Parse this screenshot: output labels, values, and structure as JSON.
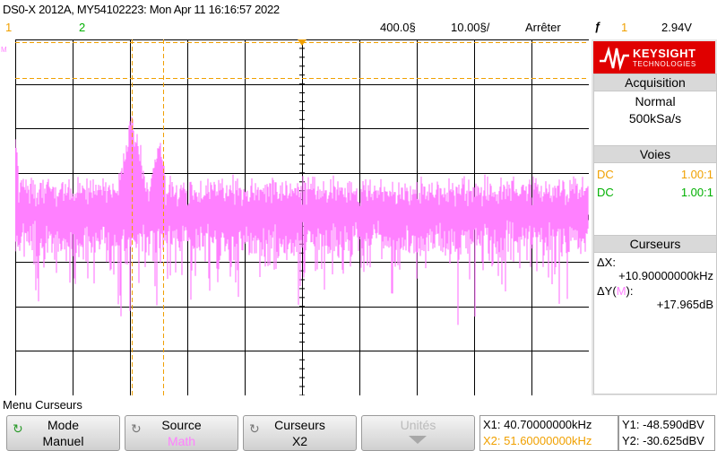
{
  "header": {
    "title": "DS0-X 2012A, MY54102223: Mon Apr 11 16:16:57 2022",
    "timebase": "400.0§",
    "delay": "10.00§/",
    "run_state": "Arrêter",
    "trigger_icon": "trigger-edge-icon",
    "trigger_symbol": "ƒ",
    "trigger_channel": "1",
    "trigger_level": "2.94V"
  },
  "channels_row": {
    "ch1": "1",
    "ch2": "2"
  },
  "colors": {
    "ch1": "#f0a000",
    "ch2": "#00b000",
    "math": "#ff80ff",
    "cursor": "#f0a000"
  },
  "screen": {
    "math_marker": "M"
  },
  "sidebar": {
    "logo": {
      "brand": "KEYSIGHT",
      "sub": "TECHNOLOGIES"
    },
    "acquisition": {
      "title": "Acquisition",
      "mode": "Normal",
      "rate": "500kSa/s"
    },
    "voies": {
      "title": "Voies",
      "rows": [
        {
          "coupling": "DC",
          "ratio": "1.00:1"
        },
        {
          "coupling": "DC",
          "ratio": "1.00:1"
        }
      ]
    },
    "curseurs": {
      "title": "Curseurs",
      "dx_label": "ΔX:",
      "dx_value": "+10.90000000kHz",
      "dy_label": "ΔY(",
      "dy_src": "M",
      "dy_label_end": "):",
      "dy_value": "+17.965dB"
    }
  },
  "menu": {
    "title": "Menu Curseurs"
  },
  "softkeys": [
    {
      "top": "Mode",
      "bottom": "Manuel"
    },
    {
      "top": "Source",
      "bottom": "Math"
    },
    {
      "top": "Curseurs",
      "bottom": "X2"
    },
    {
      "top": "Unités",
      "bottom": ""
    }
  ],
  "readouts": {
    "x1": "X1: 40.70000000kHz",
    "x2": "X2: 51.60000000kHz",
    "y1": "Y1: -48.590dBV",
    "y2": "Y2: -30.625dBV"
  }
}
